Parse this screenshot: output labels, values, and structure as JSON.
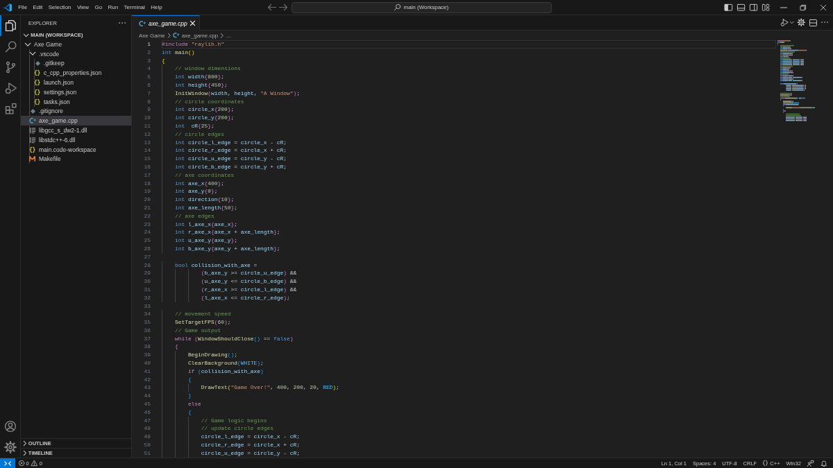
{
  "title_bar": {
    "menu": [
      "File",
      "Edit",
      "Selection",
      "View",
      "Go",
      "Run",
      "Terminal",
      "Help"
    ],
    "command_center": "main (Workspace)",
    "layout_toggles": [
      {
        "kind": "primary-sidebar",
        "on": true
      },
      {
        "kind": "panel",
        "on": false
      },
      {
        "kind": "secondary-sidebar",
        "on": false
      }
    ]
  },
  "activity_bar": [
    {
      "kind": "explorer",
      "selected": true
    },
    {
      "kind": "search",
      "selected": false
    },
    {
      "kind": "source-control",
      "selected": false
    },
    {
      "kind": "run-debug",
      "selected": false
    },
    {
      "kind": "extensions",
      "selected": false
    }
  ],
  "sidebar": {
    "title": "EXPLORER",
    "sections": [
      {
        "title": "MAIN (WORKSPACE)",
        "expanded": true,
        "tree": [
          {
            "name": "Axe Game",
            "kind": "folder",
            "expanded": true,
            "selected": false,
            "children": [
              {
                "name": ".vscode",
                "kind": "folder",
                "expanded": true,
                "selected": false,
                "children": [
                  {
                    "name": ".gitkeep",
                    "kind": "git",
                    "selected": false
                  },
                  {
                    "name": "c_cpp_properties.json",
                    "kind": "json",
                    "selected": false
                  },
                  {
                    "name": "launch.json",
                    "kind": "json",
                    "selected": false
                  },
                  {
                    "name": "settings.json",
                    "kind": "json",
                    "selected": false
                  },
                  {
                    "name": "tasks.json",
                    "kind": "json",
                    "selected": false
                  }
                ]
              },
              {
                "name": ".gitignore",
                "kind": "git",
                "selected": false
              },
              {
                "name": "axe_game.cpp",
                "kind": "cpp",
                "selected": true
              },
              {
                "name": "libgcc_s_dw2-1.dll",
                "kind": "dll",
                "selected": false
              },
              {
                "name": "libstdc++-6.dll",
                "kind": "dll",
                "selected": false
              },
              {
                "name": "main.code-workspace",
                "kind": "workspace",
                "selected": false
              },
              {
                "name": "Makefile",
                "kind": "makefile",
                "selected": false
              }
            ]
          }
        ]
      },
      {
        "title": "OUTLINE",
        "expanded": false
      },
      {
        "title": "TIMELINE",
        "expanded": false
      }
    ]
  },
  "editor": {
    "tabs": [
      {
        "label": "axe_game.cpp",
        "kind": "cpp",
        "selected": true,
        "preview": true
      }
    ],
    "breadcrumbs": [
      {
        "kind": "folder",
        "text": "Axe Game"
      },
      {
        "kind": "cpp",
        "text": "axe_game.cpp"
      },
      {
        "kind": "symbols",
        "text": "..."
      }
    ],
    "lines": [
      {
        "number": "1",
        "current": true,
        "tokens": [
          {
            "kind": "control",
            "text": "#include "
          },
          {
            "kind": "string",
            "text": "\"raylib.h\""
          }
        ]
      },
      {
        "number": "2",
        "current": false,
        "tokens": [
          {
            "kind": "keyword",
            "text": "int "
          },
          {
            "kind": "function",
            "text": "main"
          },
          {
            "kind": "bracket1",
            "text": "()"
          }
        ]
      },
      {
        "number": "3",
        "current": false,
        "tokens": [
          {
            "kind": "bracket1",
            "text": "{"
          }
        ]
      },
      {
        "number": "4",
        "current": false,
        "tokens": [
          {
            "kind": "comment",
            "text": "    // window dimensions"
          }
        ]
      },
      {
        "number": "5",
        "current": false,
        "tokens": [
          {
            "kind": "keyword",
            "text": "    int "
          },
          {
            "kind": "variable",
            "text": "width"
          },
          {
            "kind": "bracket2",
            "text": "{"
          },
          {
            "kind": "number",
            "text": "800"
          },
          {
            "kind": "bracket2",
            "text": "}"
          },
          {
            "kind": "plain",
            "text": ";"
          }
        ]
      },
      {
        "number": "6",
        "current": false,
        "tokens": [
          {
            "kind": "keyword",
            "text": "    int "
          },
          {
            "kind": "variable",
            "text": "height"
          },
          {
            "kind": "bracket2",
            "text": "{"
          },
          {
            "kind": "number",
            "text": "450"
          },
          {
            "kind": "bracket2",
            "text": "}"
          },
          {
            "kind": "plain",
            "text": ";"
          }
        ]
      },
      {
        "number": "7",
        "current": false,
        "tokens": [
          {
            "kind": "function",
            "text": "    InitWindow"
          },
          {
            "kind": "bracket2",
            "text": "("
          },
          {
            "kind": "variable",
            "text": "width"
          },
          {
            "kind": "plain",
            "text": ", "
          },
          {
            "kind": "variable",
            "text": "height"
          },
          {
            "kind": "plain",
            "text": ", "
          },
          {
            "kind": "string",
            "text": "\"A Window\""
          },
          {
            "kind": "bracket2",
            "text": ")"
          },
          {
            "kind": "plain",
            "text": ";"
          }
        ]
      },
      {
        "number": "8",
        "current": false,
        "tokens": [
          {
            "kind": "comment",
            "text": "    // circle coordinates"
          }
        ]
      },
      {
        "number": "9",
        "current": false,
        "tokens": [
          {
            "kind": "keyword",
            "text": "    int "
          },
          {
            "kind": "variable",
            "text": "circle_x"
          },
          {
            "kind": "bracket2",
            "text": "{"
          },
          {
            "kind": "number",
            "text": "200"
          },
          {
            "kind": "bracket2",
            "text": "}"
          },
          {
            "kind": "plain",
            "text": ";"
          }
        ]
      },
      {
        "number": "10",
        "current": false,
        "tokens": [
          {
            "kind": "keyword",
            "text": "    int "
          },
          {
            "kind": "variable",
            "text": "circle_y"
          },
          {
            "kind": "bracket2",
            "text": "{"
          },
          {
            "kind": "number",
            "text": "200"
          },
          {
            "kind": "bracket2",
            "text": "}"
          },
          {
            "kind": "plain",
            "text": ";"
          }
        ]
      },
      {
        "number": "11",
        "current": false,
        "tokens": [
          {
            "kind": "keyword",
            "text": "    int  "
          },
          {
            "kind": "variable",
            "text": "cR"
          },
          {
            "kind": "bracket2",
            "text": "{"
          },
          {
            "kind": "number",
            "text": "25"
          },
          {
            "kind": "bracket2",
            "text": "}"
          },
          {
            "kind": "plain",
            "text": ";"
          }
        ]
      },
      {
        "number": "12",
        "current": false,
        "tokens": [
          {
            "kind": "comment",
            "text": "    // circle edges"
          }
        ]
      },
      {
        "number": "13",
        "current": false,
        "tokens": [
          {
            "kind": "keyword",
            "text": "    int "
          },
          {
            "kind": "variable",
            "text": "circle_l_edge"
          },
          {
            "kind": "plain",
            "text": " = "
          },
          {
            "kind": "variable",
            "text": "circle_x"
          },
          {
            "kind": "plain",
            "text": " - "
          },
          {
            "kind": "variable",
            "text": "cR"
          },
          {
            "kind": "plain",
            "text": ";"
          }
        ]
      },
      {
        "number": "14",
        "current": false,
        "tokens": [
          {
            "kind": "keyword",
            "text": "    int "
          },
          {
            "kind": "variable",
            "text": "circle_r_edge"
          },
          {
            "kind": "plain",
            "text": " = "
          },
          {
            "kind": "variable",
            "text": "circle_x"
          },
          {
            "kind": "plain",
            "text": " + "
          },
          {
            "kind": "variable",
            "text": "cR"
          },
          {
            "kind": "plain",
            "text": ";"
          }
        ]
      },
      {
        "number": "15",
        "current": false,
        "tokens": [
          {
            "kind": "keyword",
            "text": "    int "
          },
          {
            "kind": "variable",
            "text": "circle_u_edge"
          },
          {
            "kind": "plain",
            "text": " = "
          },
          {
            "kind": "variable",
            "text": "circle_y"
          },
          {
            "kind": "plain",
            "text": " - "
          },
          {
            "kind": "variable",
            "text": "cR"
          },
          {
            "kind": "plain",
            "text": ";"
          }
        ]
      },
      {
        "number": "16",
        "current": false,
        "tokens": [
          {
            "kind": "keyword",
            "text": "    int "
          },
          {
            "kind": "variable",
            "text": "circle_b_edge"
          },
          {
            "kind": "plain",
            "text": " = "
          },
          {
            "kind": "variable",
            "text": "circle_y"
          },
          {
            "kind": "plain",
            "text": " + "
          },
          {
            "kind": "variable",
            "text": "cR"
          },
          {
            "kind": "plain",
            "text": ";"
          }
        ]
      },
      {
        "number": "17",
        "current": false,
        "tokens": [
          {
            "kind": "comment",
            "text": "    // axe coordinates"
          }
        ]
      },
      {
        "number": "18",
        "current": false,
        "tokens": [
          {
            "kind": "keyword",
            "text": "    int "
          },
          {
            "kind": "variable",
            "text": "axe_x"
          },
          {
            "kind": "bracket2",
            "text": "{"
          },
          {
            "kind": "number",
            "text": "400"
          },
          {
            "kind": "bracket2",
            "text": "}"
          },
          {
            "kind": "plain",
            "text": ";"
          }
        ]
      },
      {
        "number": "19",
        "current": false,
        "tokens": [
          {
            "kind": "keyword",
            "text": "    int "
          },
          {
            "kind": "variable",
            "text": "axe_y"
          },
          {
            "kind": "bracket2",
            "text": "{"
          },
          {
            "kind": "number",
            "text": "0"
          },
          {
            "kind": "bracket2",
            "text": "}"
          },
          {
            "kind": "plain",
            "text": ";"
          }
        ]
      },
      {
        "number": "20",
        "current": false,
        "tokens": [
          {
            "kind": "keyword",
            "text": "    int "
          },
          {
            "kind": "variable",
            "text": "direction"
          },
          {
            "kind": "bracket2",
            "text": "{"
          },
          {
            "kind": "number",
            "text": "10"
          },
          {
            "kind": "bracket2",
            "text": "}"
          },
          {
            "kind": "plain",
            "text": ";"
          }
        ]
      },
      {
        "number": "21",
        "current": false,
        "tokens": [
          {
            "kind": "keyword",
            "text": "    int "
          },
          {
            "kind": "variable",
            "text": "axe_length"
          },
          {
            "kind": "bracket2",
            "text": "{"
          },
          {
            "kind": "number",
            "text": "50"
          },
          {
            "kind": "bracket2",
            "text": "}"
          },
          {
            "kind": "plain",
            "text": ";"
          }
        ]
      },
      {
        "number": "22",
        "current": false,
        "tokens": [
          {
            "kind": "comment",
            "text": "    // axe edges"
          }
        ]
      },
      {
        "number": "23",
        "current": false,
        "tokens": [
          {
            "kind": "keyword",
            "text": "    int "
          },
          {
            "kind": "variable",
            "text": "l_axe_x"
          },
          {
            "kind": "bracket2",
            "text": "{"
          },
          {
            "kind": "variable",
            "text": "axe_x"
          },
          {
            "kind": "bracket2",
            "text": "}"
          },
          {
            "kind": "plain",
            "text": ";"
          }
        ]
      },
      {
        "number": "24",
        "current": false,
        "tokens": [
          {
            "kind": "keyword",
            "text": "    int "
          },
          {
            "kind": "variable",
            "text": "r_axe_x"
          },
          {
            "kind": "bracket2",
            "text": "{"
          },
          {
            "kind": "variable",
            "text": "axe_x"
          },
          {
            "kind": "plain",
            "text": " + "
          },
          {
            "kind": "variable",
            "text": "axe_length"
          },
          {
            "kind": "bracket2",
            "text": "}"
          },
          {
            "kind": "plain",
            "text": ";"
          }
        ]
      },
      {
        "number": "25",
        "current": false,
        "tokens": [
          {
            "kind": "keyword",
            "text": "    int "
          },
          {
            "kind": "variable",
            "text": "u_axe_y"
          },
          {
            "kind": "bracket2",
            "text": "{"
          },
          {
            "kind": "variable",
            "text": "axe_y"
          },
          {
            "kind": "bracket2",
            "text": "}"
          },
          {
            "kind": "plain",
            "text": ";"
          }
        ]
      },
      {
        "number": "26",
        "current": false,
        "tokens": [
          {
            "kind": "keyword",
            "text": "    int "
          },
          {
            "kind": "variable",
            "text": "b_axe_y"
          },
          {
            "kind": "bracket2",
            "text": "{"
          },
          {
            "kind": "variable",
            "text": "axe_y"
          },
          {
            "kind": "plain",
            "text": " + "
          },
          {
            "kind": "variable",
            "text": "axe_length"
          },
          {
            "kind": "bracket2",
            "text": "}"
          },
          {
            "kind": "plain",
            "text": ";"
          }
        ]
      },
      {
        "number": "27",
        "current": false
      },
      {
        "number": "28",
        "current": false,
        "tokens": [
          {
            "kind": "keyword",
            "text": "    bool "
          },
          {
            "kind": "variable",
            "text": "collision_with_axe"
          },
          {
            "kind": "plain",
            "text": " ="
          }
        ]
      },
      {
        "number": "29",
        "current": false,
        "tokens": [
          {
            "kind": "bracket2",
            "text": "            ("
          },
          {
            "kind": "variable",
            "text": "b_axe_y"
          },
          {
            "kind": "plain",
            "text": " >= "
          },
          {
            "kind": "variable",
            "text": "circle_u_edge"
          },
          {
            "kind": "bracket2",
            "text": ")"
          },
          {
            "kind": "plain",
            "text": " &&"
          }
        ]
      },
      {
        "number": "30",
        "current": false,
        "tokens": [
          {
            "kind": "bracket2",
            "text": "            ("
          },
          {
            "kind": "variable",
            "text": "u_axe_y"
          },
          {
            "kind": "plain",
            "text": " <= "
          },
          {
            "kind": "variable",
            "text": "circle_b_edge"
          },
          {
            "kind": "bracket2",
            "text": ")"
          },
          {
            "kind": "plain",
            "text": " &&"
          }
        ]
      },
      {
        "number": "31",
        "current": false,
        "tokens": [
          {
            "kind": "bracket2",
            "text": "            ("
          },
          {
            "kind": "variable",
            "text": "r_axe_x"
          },
          {
            "kind": "plain",
            "text": " >= "
          },
          {
            "kind": "variable",
            "text": "circle_l_edge"
          },
          {
            "kind": "bracket2",
            "text": ")"
          },
          {
            "kind": "plain",
            "text": " &&"
          }
        ]
      },
      {
        "number": "32",
        "current": false,
        "tokens": [
          {
            "kind": "bracket2",
            "text": "            ("
          },
          {
            "kind": "variable",
            "text": "l_axe_x"
          },
          {
            "kind": "plain",
            "text": " <= "
          },
          {
            "kind": "variable",
            "text": "circle_r_edge"
          },
          {
            "kind": "bracket2",
            "text": ")"
          },
          {
            "kind": "plain",
            "text": ";"
          }
        ]
      },
      {
        "number": "33",
        "current": false
      },
      {
        "number": "34",
        "current": false,
        "tokens": [
          {
            "kind": "comment",
            "text": "    // movement speed"
          }
        ]
      },
      {
        "number": "35",
        "current": false,
        "tokens": [
          {
            "kind": "function",
            "text": "    SetTargetFPS"
          },
          {
            "kind": "bracket2",
            "text": "("
          },
          {
            "kind": "number",
            "text": "60"
          },
          {
            "kind": "bracket2",
            "text": ")"
          },
          {
            "kind": "plain",
            "text": ";"
          }
        ]
      },
      {
        "number": "36",
        "current": false,
        "tokens": [
          {
            "kind": "comment",
            "text": "    // Game output"
          }
        ]
      },
      {
        "number": "37",
        "current": false,
        "tokens": [
          {
            "kind": "control",
            "text": "    while "
          },
          {
            "kind": "bracket2",
            "text": "("
          },
          {
            "kind": "function",
            "text": "WindowShouldClose"
          },
          {
            "kind": "bracket3",
            "text": "()"
          },
          {
            "kind": "plain",
            "text": " == "
          },
          {
            "kind": "keyword",
            "text": "false"
          },
          {
            "kind": "bracket2",
            "text": ")"
          }
        ]
      },
      {
        "number": "38",
        "current": false,
        "tokens": [
          {
            "kind": "bracket2",
            "text": "    {"
          }
        ]
      },
      {
        "number": "39",
        "current": false,
        "tokens": [
          {
            "kind": "function",
            "text": "        BeginDrawing"
          },
          {
            "kind": "bracket3",
            "text": "()"
          },
          {
            "kind": "plain",
            "text": ";"
          }
        ]
      },
      {
        "number": "40",
        "current": false,
        "tokens": [
          {
            "kind": "function",
            "text": "        ClearBackground"
          },
          {
            "kind": "bracket3",
            "text": "("
          },
          {
            "kind": "constant",
            "text": "WHITE"
          },
          {
            "kind": "bracket3",
            "text": ")"
          },
          {
            "kind": "plain",
            "text": ";"
          }
        ]
      },
      {
        "number": "41",
        "current": false,
        "tokens": [
          {
            "kind": "control",
            "text": "        if "
          },
          {
            "kind": "bracket3",
            "text": "("
          },
          {
            "kind": "variable",
            "text": "collision_with_axe"
          },
          {
            "kind": "bracket3",
            "text": ")"
          }
        ]
      },
      {
        "number": "42",
        "current": false,
        "tokens": [
          {
            "kind": "bracket3",
            "text": "        {"
          }
        ]
      },
      {
        "number": "43",
        "current": false,
        "tokens": [
          {
            "kind": "function",
            "text": "            DrawText"
          },
          {
            "kind": "bracket1",
            "text": "("
          },
          {
            "kind": "string",
            "text": "\"Game Over!\""
          },
          {
            "kind": "plain",
            "text": ", "
          },
          {
            "kind": "number",
            "text": "400"
          },
          {
            "kind": "plain",
            "text": ", "
          },
          {
            "kind": "number",
            "text": "200"
          },
          {
            "kind": "plain",
            "text": ", "
          },
          {
            "kind": "number",
            "text": "20"
          },
          {
            "kind": "plain",
            "text": ", "
          },
          {
            "kind": "constant",
            "text": "RED"
          },
          {
            "kind": "bracket1",
            "text": ")"
          },
          {
            "kind": "plain",
            "text": ";"
          }
        ]
      },
      {
        "number": "44",
        "current": false,
        "tokens": [
          {
            "kind": "bracket3",
            "text": "        }"
          }
        ]
      },
      {
        "number": "45",
        "current": false,
        "tokens": [
          {
            "kind": "control",
            "text": "        else"
          }
        ]
      },
      {
        "number": "46",
        "current": false,
        "tokens": [
          {
            "kind": "bracket3",
            "text": "        {"
          }
        ]
      },
      {
        "number": "47",
        "current": false,
        "tokens": [
          {
            "kind": "comment",
            "text": "            // Game logic begins"
          }
        ]
      },
      {
        "number": "48",
        "current": false,
        "tokens": [
          {
            "kind": "comment",
            "text": "            // update circle edges"
          }
        ]
      },
      {
        "number": "49",
        "current": false,
        "tokens": [
          {
            "kind": "variable",
            "text": "            circle_l_edge"
          },
          {
            "kind": "plain",
            "text": " = "
          },
          {
            "kind": "variable",
            "text": "circle_x"
          },
          {
            "kind": "plain",
            "text": " - "
          },
          {
            "kind": "variable",
            "text": "cR"
          },
          {
            "kind": "plain",
            "text": ";"
          }
        ]
      },
      {
        "number": "50",
        "current": false,
        "tokens": [
          {
            "kind": "variable",
            "text": "            circle_r_edge"
          },
          {
            "kind": "plain",
            "text": " = "
          },
          {
            "kind": "variable",
            "text": "circle_x"
          },
          {
            "kind": "plain",
            "text": " + "
          },
          {
            "kind": "variable",
            "text": "cR"
          },
          {
            "kind": "plain",
            "text": ";"
          }
        ]
      },
      {
        "number": "51",
        "current": false,
        "tokens": [
          {
            "kind": "variable",
            "text": "            circle_u_edge"
          },
          {
            "kind": "plain",
            "text": " = "
          },
          {
            "kind": "variable",
            "text": "circle_y"
          },
          {
            "kind": "plain",
            "text": " - "
          },
          {
            "kind": "variable",
            "text": "cR"
          },
          {
            "kind": "plain",
            "text": ";"
          }
        ]
      }
    ]
  },
  "status_bar": {
    "errors": "0",
    "warnings": "0",
    "items": [
      {
        "kind": "text",
        "text": "Ln 1, Col 1"
      },
      {
        "kind": "text",
        "text": "Spaces: 4"
      },
      {
        "kind": "text",
        "text": "UTF-8"
      },
      {
        "kind": "text",
        "text": "CRLF"
      },
      {
        "kind": "language",
        "text": "C++"
      },
      {
        "kind": "text",
        "text": "Win32"
      }
    ]
  }
}
